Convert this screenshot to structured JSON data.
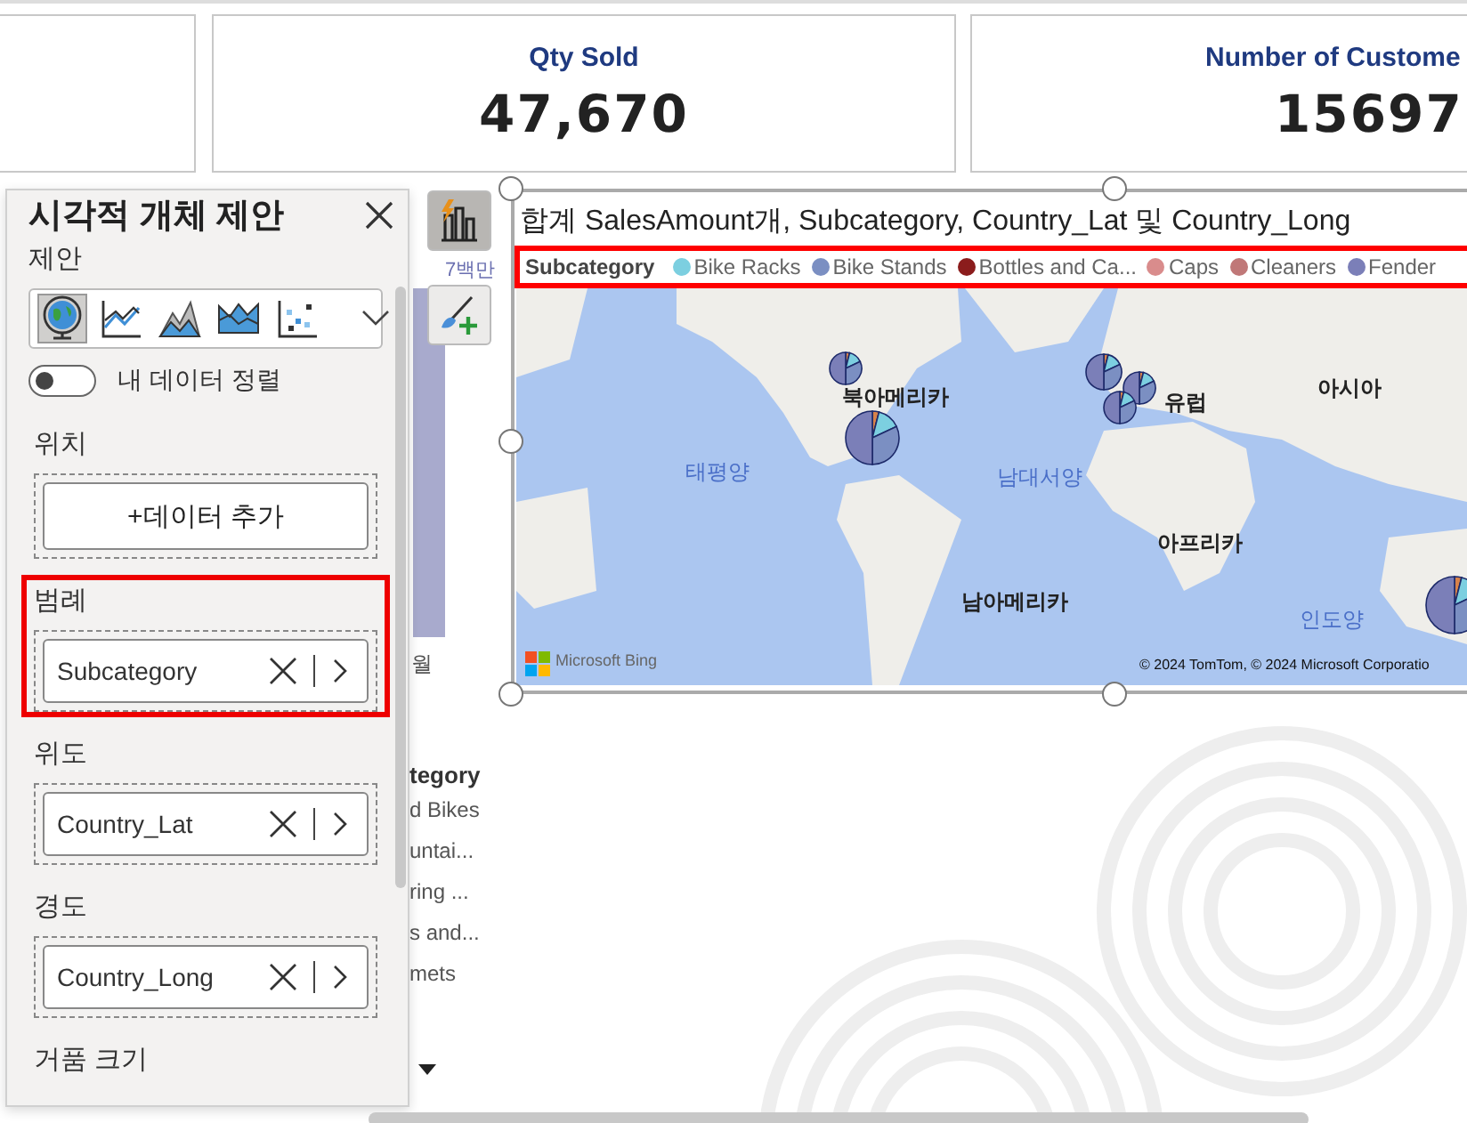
{
  "cards": [
    {
      "title": "Qty Sold",
      "value": "47,670"
    },
    {
      "title": "Number of Custome",
      "value": "15697"
    }
  ],
  "background_chart": {
    "axis_label": "7백만",
    "x_label": "월",
    "legend_title": "tegory",
    "legend_items": [
      "d Bikes",
      "untai...",
      "ring ...",
      "s and...",
      "mets"
    ]
  },
  "suggestion_panel": {
    "title": "시각적 개체 제안",
    "suggestions_label": "제안",
    "suggestions": [
      {
        "kind": "map",
        "selected": true
      },
      {
        "kind": "line",
        "selected": false
      },
      {
        "kind": "area",
        "selected": false
      },
      {
        "kind": "ribbon",
        "selected": false
      },
      {
        "kind": "scatter",
        "selected": false
      }
    ],
    "toggle": {
      "label": "내 데이터 정렬",
      "on": false
    },
    "wells": [
      {
        "label": "위치",
        "kind": "add",
        "button": "+데이터 추가",
        "highlighted": false
      },
      {
        "label": "범례",
        "kind": "field",
        "value": "Subcategory",
        "highlighted": true
      },
      {
        "label": "위도",
        "kind": "field",
        "value": "Country_Lat",
        "highlighted": false
      },
      {
        "label": "경도",
        "kind": "field",
        "value": "Country_Long",
        "highlighted": false
      },
      {
        "label": "거품 크기",
        "kind": "label",
        "highlighted": false
      }
    ]
  },
  "map_visual": {
    "title": "합계 SalesAmount개, Subcategory, Country_Lat 및 Country_Long",
    "legend": {
      "title": "Subcategory",
      "highlighted": true,
      "items": [
        {
          "label": "Bike Racks",
          "color": "#7ccfe0"
        },
        {
          "label": "Bike Stands",
          "color": "#7b8fc2"
        },
        {
          "label": "Bottles and Ca...",
          "color": "#8b1c1c"
        },
        {
          "label": "Caps",
          "color": "#d98c8c"
        },
        {
          "label": "Cleaners",
          "color": "#c07878"
        },
        {
          "label": "Fender",
          "color": "#7b7fb8"
        }
      ]
    },
    "labels": [
      {
        "text": "북아메리카",
        "kind": "continent"
      },
      {
        "text": "유럽",
        "kind": "continent"
      },
      {
        "text": "아시아",
        "kind": "continent"
      },
      {
        "text": "태평양",
        "kind": "ocean"
      },
      {
        "text": "남대서양",
        "kind": "ocean"
      },
      {
        "text": "아프리카",
        "kind": "continent"
      },
      {
        "text": "남아메리카",
        "kind": "continent"
      },
      {
        "text": "인도양",
        "kind": "ocean"
      }
    ],
    "logo": "Microsoft Bing",
    "attribution": "© 2024 TomTom, © 2024 Microsoft Corporatio"
  }
}
